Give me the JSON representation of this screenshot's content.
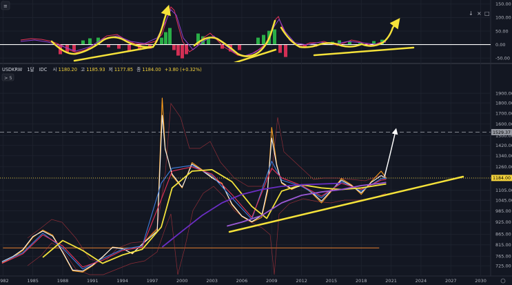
{
  "chart_data": [
    {
      "type": "line",
      "panel": "oscillator",
      "y_ticks": [
        "150.00",
        "100.00",
        "50.00",
        "0.00",
        "-50.00"
      ],
      "ylim": [
        -65,
        165
      ],
      "zero_line": 0,
      "grid": true,
      "controls": [
        "↓",
        "×",
        "□"
      ]
    },
    {
      "type": "line",
      "panel": "price",
      "header": {
        "symbol": "USDKRW",
        "interval": "1달",
        "exchange": "IDC",
        "open_label": "시",
        "open": "1180.20",
        "high_label": "고",
        "high": "1185.93",
        "low_label": "저",
        "low": "1177.85",
        "close_label": "종",
        "close": "1184.00",
        "change": "+3.80 (+0.32%)"
      },
      "indicator_toggle": "> 5",
      "scale": "log",
      "ylim": [
        690,
        2030
      ],
      "y_ticks": [
        1900,
        1800,
        1700,
        1600,
        1500,
        1420,
        1340,
        1260,
        1180,
        1105,
        1045,
        985,
        925,
        865,
        815,
        765,
        725
      ],
      "x_ticks": [
        "1982",
        "1985",
        "1988",
        "1991",
        "1994",
        "1997",
        "2000",
        "2003",
        "2006",
        "2009",
        "2012",
        "2015",
        "2018",
        "2021",
        "2024",
        "2027",
        "2030"
      ],
      "xlim": [
        1981.7,
        2031.0
      ],
      "hlines": [
        {
          "value": 1529.37,
          "label": "1529.37",
          "style": "dashed",
          "color": "#9598a1"
        },
        {
          "value": 1184.0,
          "label": "1184.00",
          "style": "dotted",
          "color": "#f2d13c"
        },
        {
          "value": 801,
          "label": "",
          "style": "solid",
          "color": "#e8802f"
        }
      ],
      "series": [
        {
          "color": "#ff9f1c",
          "points": [
            [
              1981.9,
              737
            ],
            [
              1983.0,
              760
            ],
            [
              1984.0,
              790
            ],
            [
              1985.0,
              850
            ],
            [
              1986.0,
              885
            ],
            [
              1987.0,
              860
            ],
            [
              1988.0,
              780
            ],
            [
              1989.0,
              705
            ],
            [
              1990.0,
              700
            ],
            [
              1991.0,
              725
            ],
            [
              1992.0,
              760
            ],
            [
              1993.0,
              805
            ],
            [
              1994.0,
              800
            ],
            [
              1995.0,
              775
            ],
            [
              1996.0,
              820
            ],
            [
              1997.5,
              890
            ],
            [
              1997.9,
              1600
            ],
            [
              1998.0,
              1850
            ],
            [
              1998.3,
              1400
            ],
            [
              1999.0,
              1200
            ],
            [
              2000.0,
              1120
            ],
            [
              2001.0,
              1290
            ],
            [
              2002.0,
              1240
            ],
            [
              2003.0,
              1190
            ],
            [
              2004.0,
              1150
            ],
            [
              2005.0,
              1020
            ],
            [
              2006.0,
              955
            ],
            [
              2007.0,
              925
            ],
            [
              2008.0,
              950
            ],
            [
              2008.6,
              1100
            ],
            [
              2009.0,
              1570
            ],
            [
              2009.5,
              1280
            ],
            [
              2010.0,
              1150
            ],
            [
              2011.0,
              1110
            ],
            [
              2012.0,
              1140
            ],
            [
              2013.0,
              1090
            ],
            [
              2014.0,
              1030
            ],
            [
              2015.0,
              1100
            ],
            [
              2016.0,
              1180
            ],
            [
              2017.0,
              1140
            ],
            [
              2018.0,
              1080
            ],
            [
              2019.0,
              1160
            ],
            [
              2020.0,
              1230
            ],
            [
              2020.5,
              1184
            ]
          ]
        },
        {
          "color": "#f5f5f5",
          "points": [
            [
              1981.9,
              742
            ],
            [
              1983.0,
              764
            ],
            [
              1984.0,
              794
            ],
            [
              1985.0,
              854
            ],
            [
              1986.0,
              880
            ],
            [
              1987.0,
              855
            ],
            [
              1988.0,
              783
            ],
            [
              1989.0,
              708
            ],
            [
              1990.0,
              704
            ],
            [
              1991.0,
              728
            ],
            [
              1992.0,
              762
            ],
            [
              1993.0,
              803
            ],
            [
              1994.0,
              798
            ],
            [
              1995.0,
              777
            ],
            [
              1996.0,
              818
            ],
            [
              1997.5,
              880
            ],
            [
              1997.9,
              1480
            ],
            [
              1998.0,
              1680
            ],
            [
              1998.3,
              1390
            ],
            [
              1999.0,
              1210
            ],
            [
              2000.0,
              1125
            ],
            [
              2001.0,
              1280
            ],
            [
              2002.0,
              1235
            ],
            [
              2003.0,
              1185
            ],
            [
              2004.0,
              1145
            ],
            [
              2005.0,
              1025
            ],
            [
              2006.0,
              958
            ],
            [
              2007.0,
              928
            ],
            [
              2008.0,
              960
            ],
            [
              2008.6,
              1120
            ],
            [
              2009.0,
              1480
            ],
            [
              2009.5,
              1270
            ],
            [
              2010.0,
              1155
            ],
            [
              2011.0,
              1115
            ],
            [
              2012.0,
              1135
            ],
            [
              2013.0,
              1095
            ],
            [
              2014.0,
              1040
            ],
            [
              2015.0,
              1105
            ],
            [
              2016.0,
              1170
            ],
            [
              2017.0,
              1135
            ],
            [
              2018.0,
              1090
            ],
            [
              2019.0,
              1155
            ],
            [
              2020.0,
              1200
            ],
            [
              2020.5,
              1180
            ]
          ]
        },
        {
          "color": "#3f7fe0",
          "points": [
            [
              1981.9,
              740
            ],
            [
              1984.0,
              780
            ],
            [
              1986.0,
              870
            ],
            [
              1988.0,
              800
            ],
            [
              1990.0,
              712
            ],
            [
              1992.0,
              755
            ],
            [
              1994.0,
              795
            ],
            [
              1996.0,
              810
            ],
            [
              1997.9,
              1150
            ],
            [
              1999.0,
              1250
            ],
            [
              2001.0,
              1270
            ],
            [
              2003.0,
              1200
            ],
            [
              2005.0,
              1060
            ],
            [
              2007.0,
              940
            ],
            [
              2009.0,
              1300
            ],
            [
              2010.0,
              1170
            ],
            [
              2012.0,
              1130
            ],
            [
              2014.0,
              1060
            ],
            [
              2016.0,
              1160
            ],
            [
              2018.0,
              1100
            ],
            [
              2020.0,
              1180
            ],
            [
              2020.5,
              1182
            ]
          ]
        },
        {
          "color": "#e8325a",
          "points": [
            [
              1981.9,
              735
            ],
            [
              1984.0,
              775
            ],
            [
              1986.0,
              862
            ],
            [
              1988.0,
              810
            ],
            [
              1990.0,
              720
            ],
            [
              1992.0,
              748
            ],
            [
              1994.0,
              790
            ],
            [
              1996.0,
              805
            ],
            [
              1997.9,
              1050
            ],
            [
              1999.0,
              1230
            ],
            [
              2001.0,
              1260
            ],
            [
              2003.0,
              1210
            ],
            [
              2005.0,
              1080
            ],
            [
              2007.0,
              950
            ],
            [
              2009.0,
              1250
            ],
            [
              2010.0,
              1185
            ],
            [
              2012.0,
              1135
            ],
            [
              2014.0,
              1070
            ],
            [
              2016.0,
              1150
            ],
            [
              2018.0,
              1110
            ],
            [
              2020.0,
              1170
            ],
            [
              2020.5,
              1175
            ]
          ]
        },
        {
          "color": "#f2e23c",
          "points": [
            [
              1986.0,
              760
            ],
            [
              1988.0,
              835
            ],
            [
              1990.0,
              790
            ],
            [
              1992.0,
              735
            ],
            [
              1994.0,
              770
            ],
            [
              1996.0,
              795
            ],
            [
              1997.9,
              900
            ],
            [
              1999.0,
              1120
            ],
            [
              2001.0,
              1230
            ],
            [
              2003.0,
              1240
            ],
            [
              2005.0,
              1160
            ],
            [
              2007.0,
              1010
            ],
            [
              2008.5,
              945
            ],
            [
              2010.0,
              1100
            ],
            [
              2012.0,
              1140
            ],
            [
              2014.0,
              1120
            ],
            [
              2016.0,
              1110
            ],
            [
              2018.0,
              1120
            ],
            [
              2020.0,
              1140
            ],
            [
              2020.5,
              1145
            ]
          ]
        },
        {
          "color": "#6a2ec4",
          "points": [
            [
              1998.0,
              805
            ],
            [
              2000.0,
              880
            ],
            [
              2002.0,
              960
            ],
            [
              2004.0,
              1030
            ],
            [
              2006.0,
              1080
            ],
            [
              2008.0,
              1110
            ],
            [
              2010.0,
              1130
            ],
            [
              2012.0,
              1140
            ],
            [
              2014.0,
              1145
            ],
            [
              2016.0,
              1150
            ]
          ]
        },
        {
          "color": "#9b59d6",
          "points": [
            [
              2004.5,
              905
            ],
            [
              2006.0,
              925
            ],
            [
              2008.0,
              960
            ],
            [
              2010.0,
              1030
            ],
            [
              2012.0,
              1075
            ],
            [
              2014.0,
              1095
            ],
            [
              2016.0,
              1110
            ],
            [
              2018.0,
              1135
            ],
            [
              2020.0,
              1150
            ],
            [
              2020.5,
              1155
            ]
          ]
        }
      ]
    }
  ]
}
